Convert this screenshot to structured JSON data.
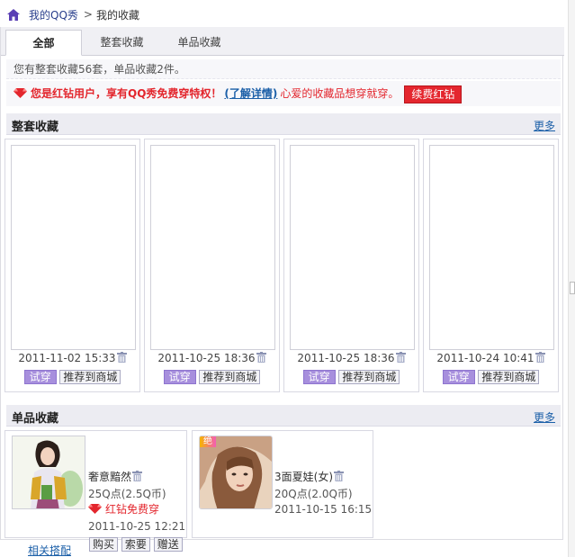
{
  "breadcrumb": {
    "home": "我的QQ秀",
    "separator": ">",
    "current": "我的收藏"
  },
  "tabs": [
    {
      "label": "全部",
      "active": true
    },
    {
      "label": "整套收藏",
      "active": false
    },
    {
      "label": "单品收藏",
      "active": false
    }
  ],
  "summary": "您有整套收藏56套，单品收藏2件。",
  "vip": {
    "text": "您是红钻用户，享有QQ秀免费穿特权！",
    "link": "(了解详情)",
    "rest": "心爱的收藏品想穿就穿。",
    "button": "续费红钻"
  },
  "sets_section": {
    "title": "整套收藏",
    "more": "更多",
    "try_label": "试穿",
    "recommend_label": "推荐到商城",
    "items": [
      {
        "date": "2011-11-02 15:33"
      },
      {
        "date": "2011-10-25 18:36"
      },
      {
        "date": "2011-10-25 18:36"
      },
      {
        "date": "2011-10-24 10:41"
      }
    ]
  },
  "items_section": {
    "title": "单品收藏",
    "more": "更多",
    "items": [
      {
        "name": "奢意黯然",
        "price": "25Q点(2.5Q币)",
        "free": "红钻免费穿",
        "date": "2011-10-25 12:21",
        "related": "相关搭配",
        "actions": [
          "购买",
          "索要",
          "赠送"
        ]
      },
      {
        "badge": "绝",
        "name": "3面夏娃(女)",
        "price": "20Q点(2.0Q币)",
        "date": "2011-10-15 16:15"
      }
    ]
  },
  "colors": {
    "accent_red": "#e3262d",
    "link_blue": "#1b5fa8",
    "try_purple": "#a78fdd"
  }
}
